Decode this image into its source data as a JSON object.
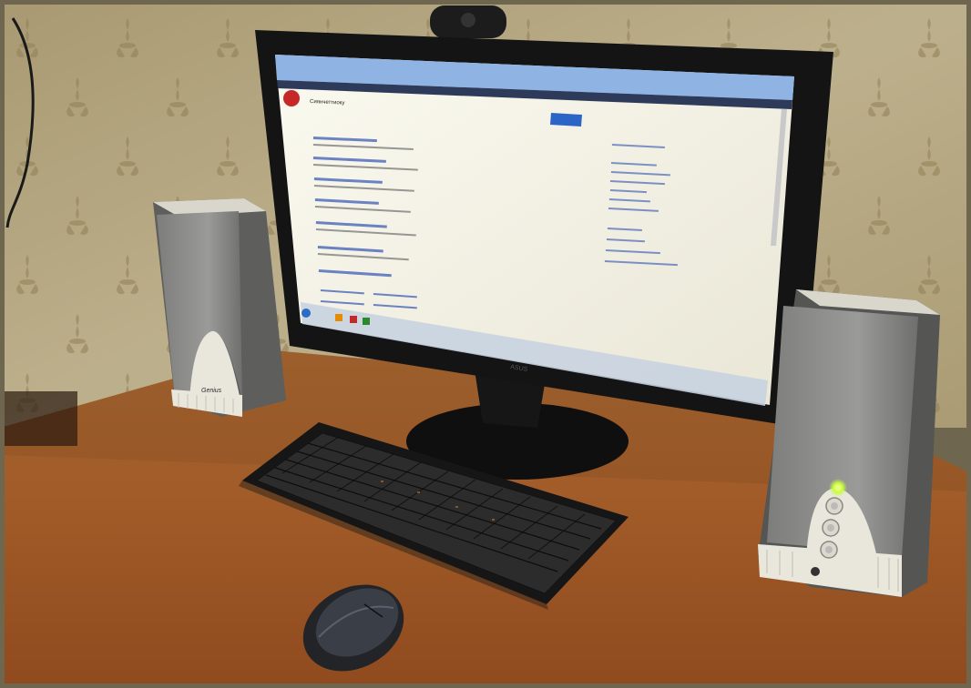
{
  "photo": {
    "subject": "desktop computer setup on a wooden desk",
    "speaker_brand": "Genius",
    "screen_tab_title": "Сиянчеттиоку",
    "colors": {
      "wallpaper": "#c9b98f",
      "wallpaper_pattern": "#9c8a5e",
      "desk": "#a8612e",
      "desk_dark": "#7a4520",
      "monitor_bezel": "#141414",
      "screen_bg": "#f4f2e6",
      "screen_accent": "#2b66c6",
      "speaker_body": "#8e8e8c",
      "speaker_front": "#e9e6dc",
      "power_led": "#c6ff3a",
      "keyboard": "#1b1b1b",
      "mouse": "#2a2d33"
    }
  }
}
